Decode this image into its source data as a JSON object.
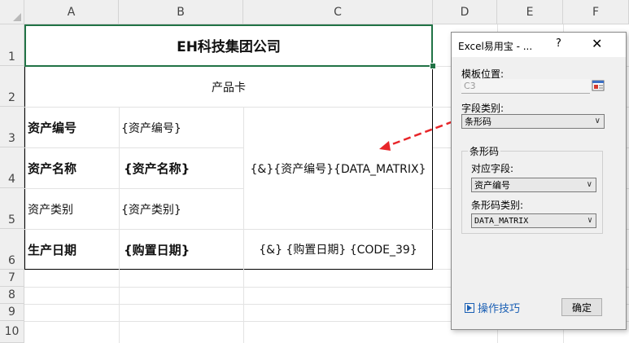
{
  "sheet": {
    "columns": [
      "A",
      "B",
      "C",
      "D",
      "E",
      "F"
    ],
    "rows": [
      "1",
      "2",
      "3",
      "4",
      "5",
      "6",
      "7",
      "8",
      "9",
      "10"
    ],
    "title": "EH科技集团公司",
    "subtitle": "产品卡",
    "labels": {
      "r3a": "资产编号",
      "r3b": "{资产编号}",
      "r4a": "资产名称",
      "r4b": "{资产名称}",
      "r5a": "资产类别",
      "r5b": "{资产类别}",
      "r6a": "生产日期",
      "r6b": "{购置日期}",
      "c34": "{&}{资产编号}{DATA_MATRIX}",
      "c6": "{&} {购置日期} {CODE_39}"
    }
  },
  "dialog": {
    "title": "Excel易用宝 - ...",
    "help_glyph": "?",
    "close_glyph": "✕",
    "template_position_label": "模板位置:",
    "template_position_value": "C3",
    "field_type_label": "字段类别:",
    "field_type_value": "条形码",
    "group_title": "条形码",
    "field_label": "对应字段:",
    "field_value": "资产编号",
    "barcode_type_label": "条形码类别:",
    "barcode_type_value": "DATA_MATRIX",
    "tips_label": "操作技巧",
    "confirm_label": "确定"
  },
  "colors": {
    "selection": "#217346",
    "arrow": "#e8262a",
    "link": "#1a5fb4"
  }
}
